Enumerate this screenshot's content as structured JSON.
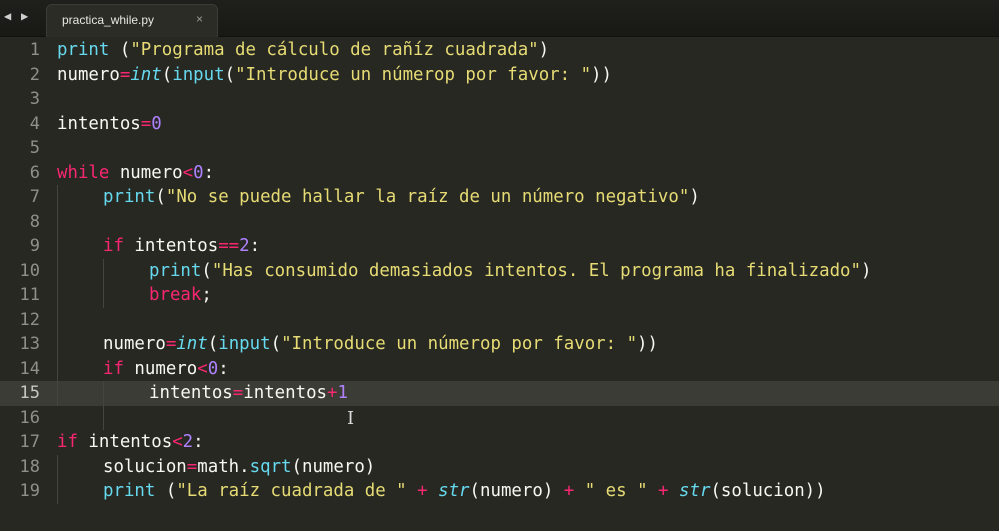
{
  "tab": {
    "filename": "practica_while.py",
    "close_glyph": "×"
  },
  "nav": {
    "back": "◀",
    "forward": "▶"
  },
  "colors": {
    "background": "#272822",
    "text": "#f8f8f2",
    "keyword": "#f92672",
    "function": "#66d9ef",
    "string": "#e6db74",
    "number": "#ae81ff",
    "gutter": "#8f908a",
    "active_line": "#3b3c35"
  },
  "active_line": 15,
  "lines": [
    {
      "number": "1",
      "indent": 0,
      "tokens": [
        [
          "print",
          "fn"
        ],
        [
          " (",
          ""
        ],
        [
          "\"Programa de cálculo de rañíz cuadrada\"",
          "str"
        ],
        [
          ")",
          ""
        ]
      ]
    },
    {
      "number": "2",
      "indent": 0,
      "tokens": [
        [
          "numero",
          ""
        ],
        [
          "=",
          "kw"
        ],
        [
          "int",
          "fni"
        ],
        [
          "(",
          ""
        ],
        [
          "input",
          "fn"
        ],
        [
          "(",
          ""
        ],
        [
          "\"Introduce un númerop por favor: \"",
          "str"
        ],
        [
          "))",
          ""
        ]
      ]
    },
    {
      "number": "3",
      "indent": 0,
      "tokens": []
    },
    {
      "number": "4",
      "indent": 0,
      "tokens": [
        [
          "intentos",
          ""
        ],
        [
          "=",
          "kw"
        ],
        [
          "0",
          "num"
        ]
      ]
    },
    {
      "number": "5",
      "indent": 0,
      "tokens": []
    },
    {
      "number": "6",
      "indent": 0,
      "tokens": [
        [
          "while",
          "kw"
        ],
        [
          " numero",
          ""
        ],
        [
          "<",
          "kw"
        ],
        [
          "0",
          "num"
        ],
        [
          ":",
          ""
        ]
      ]
    },
    {
      "number": "7",
      "indent": 1,
      "tokens": [
        [
          "print",
          "fn"
        ],
        [
          "(",
          ""
        ],
        [
          "\"No se puede hallar la raíz de un número negativo\"",
          "str"
        ],
        [
          ")",
          ""
        ]
      ]
    },
    {
      "number": "8",
      "indent": 0,
      "tokens": []
    },
    {
      "number": "9",
      "indent": 1,
      "tokens": [
        [
          "if",
          "kw"
        ],
        [
          " intentos",
          ""
        ],
        [
          "==",
          "kw"
        ],
        [
          "2",
          "num"
        ],
        [
          ":",
          ""
        ]
      ]
    },
    {
      "number": "10",
      "indent": 2,
      "tokens": [
        [
          "print",
          "fn"
        ],
        [
          "(",
          ""
        ],
        [
          "\"Has consumido demasiados intentos. El programa ha finalizado\"",
          "str"
        ],
        [
          ")",
          ""
        ]
      ]
    },
    {
      "number": "11",
      "indent": 2,
      "tokens": [
        [
          "break",
          "kw"
        ],
        [
          ";",
          ""
        ]
      ]
    },
    {
      "number": "12",
      "indent": 0,
      "tokens": []
    },
    {
      "number": "13",
      "indent": 1,
      "tokens": [
        [
          "numero",
          ""
        ],
        [
          "=",
          "kw"
        ],
        [
          "int",
          "fni"
        ],
        [
          "(",
          ""
        ],
        [
          "input",
          "fn"
        ],
        [
          "(",
          ""
        ],
        [
          "\"Introduce un númerop por favor: \"",
          "str"
        ],
        [
          "))",
          ""
        ]
      ]
    },
    {
      "number": "14",
      "indent": 1,
      "tokens": [
        [
          "if",
          "kw"
        ],
        [
          " numero",
          ""
        ],
        [
          "<",
          "kw"
        ],
        [
          "0",
          "num"
        ],
        [
          ":",
          ""
        ]
      ]
    },
    {
      "number": "15",
      "indent": 2,
      "tokens": [
        [
          "intentos",
          ""
        ],
        [
          "=",
          "kw"
        ],
        [
          "intentos",
          ""
        ],
        [
          "+",
          "kw"
        ],
        [
          "1",
          "num"
        ]
      ]
    },
    {
      "number": "16",
      "indent": 0,
      "tokens": []
    },
    {
      "number": "17",
      "indent": 0,
      "tokens": [
        [
          "if",
          "kw"
        ],
        [
          " intentos",
          ""
        ],
        [
          "<",
          "kw"
        ],
        [
          "2",
          "num"
        ],
        [
          ":",
          ""
        ]
      ]
    },
    {
      "number": "18",
      "indent": 1,
      "tokens": [
        [
          "solucion",
          ""
        ],
        [
          "=",
          "kw"
        ],
        [
          "math",
          ""
        ],
        [
          ".",
          ""
        ],
        [
          "sqrt",
          "fn"
        ],
        [
          "(numero)",
          ""
        ]
      ]
    },
    {
      "number": "19",
      "indent": 1,
      "tokens": [
        [
          "print",
          "fn"
        ],
        [
          " (",
          ""
        ],
        [
          "\"La raíz cuadrada de \"",
          "str"
        ],
        [
          " ",
          ""
        ],
        [
          "+",
          "kw"
        ],
        [
          " ",
          ""
        ],
        [
          "str",
          "fni"
        ],
        [
          "(numero) ",
          ""
        ],
        [
          "+",
          "kw"
        ],
        [
          " ",
          ""
        ],
        [
          "\" es \"",
          "str"
        ],
        [
          " ",
          ""
        ],
        [
          "+",
          "kw"
        ],
        [
          " ",
          ""
        ],
        [
          "str",
          "fni"
        ],
        [
          "(solucion))",
          ""
        ]
      ]
    }
  ],
  "indent_guides": [
    {
      "level": 1,
      "from": 7,
      "to": 15
    },
    {
      "level": 2,
      "from": 10,
      "to": 11
    },
    {
      "level": 2,
      "from": 15,
      "to": 16
    },
    {
      "level": 1,
      "from": 18,
      "to": 19
    }
  ]
}
